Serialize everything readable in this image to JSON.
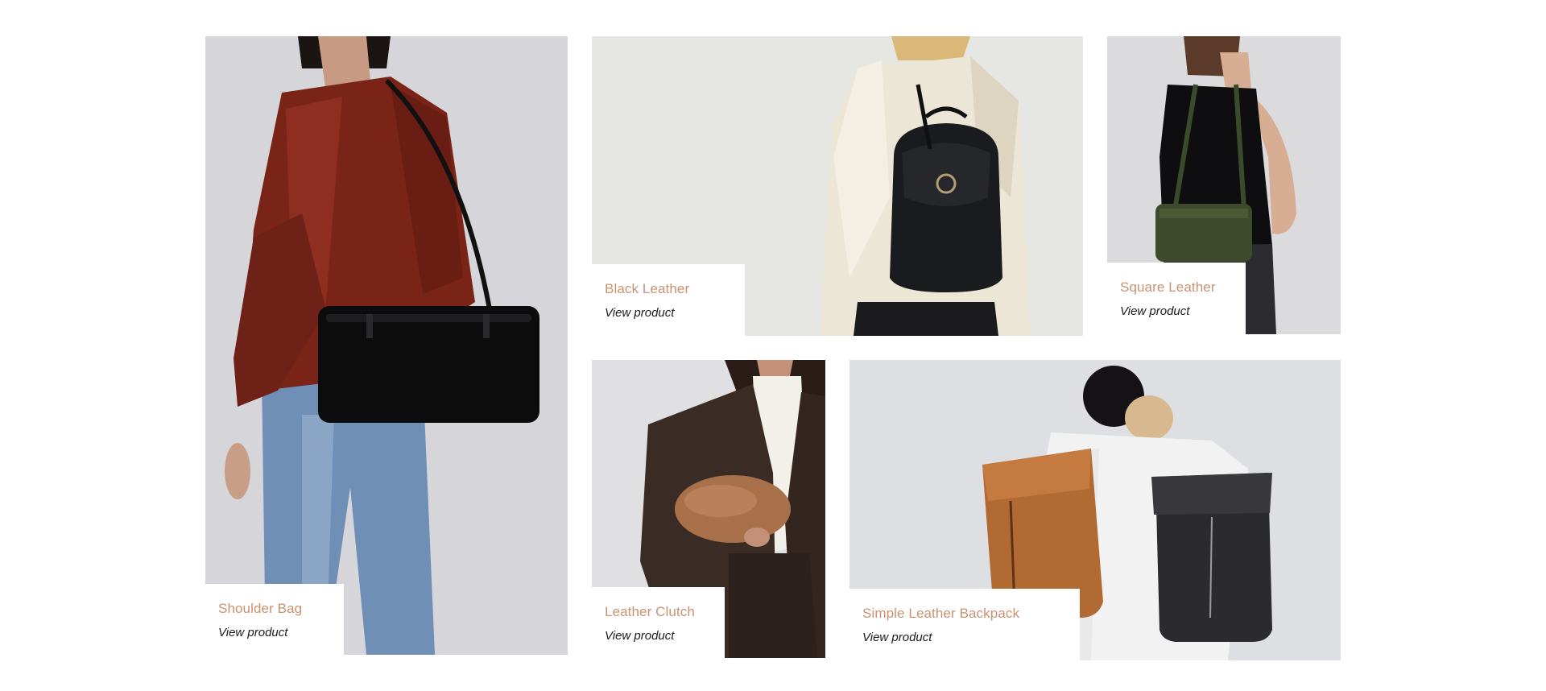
{
  "products": [
    {
      "name": "Shoulder Bag",
      "link_label": "View product"
    },
    {
      "name": "Black Leather",
      "link_label": "View product"
    },
    {
      "name": "Square Leather",
      "link_label": "View product"
    },
    {
      "name": "Leather Clutch",
      "link_label": "View product"
    },
    {
      "name": "Simple Leather Backpack",
      "link_label": "View product"
    }
  ],
  "colors": {
    "product_name": "#c99270",
    "link_text": "#1c1c1c",
    "page_background": "#ffffff"
  }
}
